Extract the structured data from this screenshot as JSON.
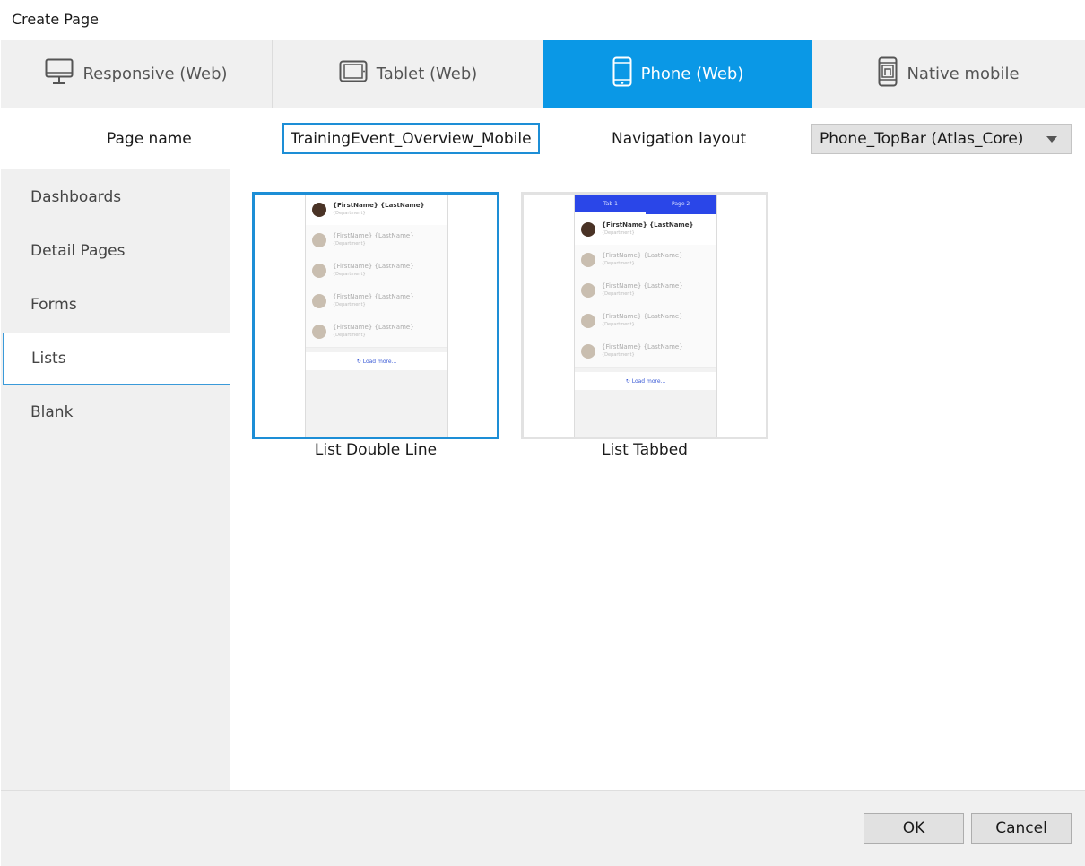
{
  "window": {
    "title": "Create Page"
  },
  "tabs": [
    {
      "label": "Responsive (Web)",
      "icon": "monitor-icon"
    },
    {
      "label": "Tablet (Web)",
      "icon": "tablet-icon"
    },
    {
      "label": "Phone (Web)",
      "icon": "phone-icon",
      "active": true
    },
    {
      "label": "Native mobile",
      "icon": "native-mobile-icon"
    }
  ],
  "form": {
    "page_name_label": "Page name",
    "page_name_value": "TrainingEvent_Overview_Mobile",
    "navigation_layout_label": "Navigation layout",
    "navigation_layout_value": "Phone_TopBar (Atlas_Core)"
  },
  "sidebar": {
    "items": [
      {
        "label": "Dashboards"
      },
      {
        "label": "Detail Pages"
      },
      {
        "label": "Forms"
      },
      {
        "label": "Lists",
        "selected": true
      },
      {
        "label": "Blank"
      }
    ]
  },
  "templates": [
    {
      "caption": "List Double Line",
      "rows": [
        {
          "name": "{FirstName} {LastName}",
          "sub": "{Department}"
        },
        {
          "name": "{FirstName} {LastName}",
          "sub": "{Department}"
        },
        {
          "name": "{FirstName} {LastName}",
          "sub": "{Department}"
        },
        {
          "name": "{FirstName} {LastName}",
          "sub": "{Department}"
        },
        {
          "name": "{FirstName} {LastName}",
          "sub": "{Department}"
        }
      ],
      "load_more": "Load more..."
    },
    {
      "caption": "List Tabbed",
      "tab1": "Tab 1",
      "tab2": "Page 2",
      "rows": [
        {
          "name": "{FirstName} {LastName}",
          "sub": "{Department}"
        },
        {
          "name": "{FirstName} {LastName}",
          "sub": "{Department}"
        },
        {
          "name": "{FirstName} {LastName}",
          "sub": "{Department}"
        },
        {
          "name": "{FirstName} {LastName}",
          "sub": "{Department}"
        },
        {
          "name": "{FirstName} {LastName}",
          "sub": "{Department}"
        }
      ],
      "load_more": "Load more..."
    }
  ],
  "footer": {
    "ok_label": "OK",
    "cancel_label": "Cancel"
  },
  "colors": {
    "accent": "#0a98e6",
    "selection_border": "#1d8ed6",
    "tab_bar": "#2a46e8"
  }
}
